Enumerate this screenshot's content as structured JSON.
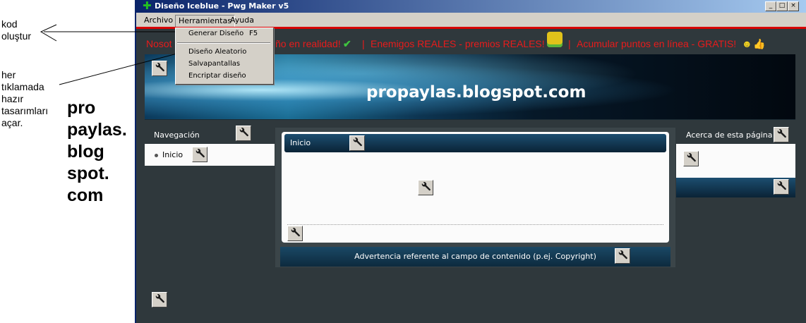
{
  "annotations": {
    "kod": [
      "kod",
      "oluştur"
    ],
    "her": [
      "her",
      "tıklamada",
      "hazır",
      "tasarımları",
      "açar."
    ],
    "brand_lines": [
      "pro",
      "paylas.",
      "blog",
      "spot.",
      "com"
    ]
  },
  "window": {
    "title": "Diseño Iceblue - Pwg Maker v5",
    "controls": [
      "_",
      "□",
      "×"
    ]
  },
  "menu": {
    "items": [
      "Archivo",
      "Herramientas",
      "Ayuda"
    ],
    "open_menu": "Herramientas",
    "dropdown": [
      {
        "label": "Generar Diseño",
        "shortcut": "F5"
      },
      {
        "label": "Diseño Aleatorio",
        "shortcut": ""
      },
      {
        "label": "Salvapantallas",
        "shortcut": ""
      },
      {
        "label": "Encriptar diseño",
        "shortcut": ""
      }
    ]
  },
  "ticker": {
    "left_text": "Nosot",
    "part1": "ño en realidad!",
    "sep1": "|",
    "part2": "Enemigos REALES - premios REALES!",
    "sep2": "|",
    "part3": "Acumular puntos en línea - GRATIS!",
    "color": "#e81b1b"
  },
  "banner": {
    "title": "propaylas.blogspot.com"
  },
  "navigation": {
    "heading": "Navegación",
    "items": [
      "Inicio"
    ]
  },
  "content": {
    "heading": "Inicio",
    "footer": "Advertencia referente al campo de contenido (p.ej. Copyright)"
  },
  "about": {
    "heading": "Acerca de esta página"
  },
  "icons": {
    "edit": "wrench-icon",
    "app": "plus-icon"
  }
}
